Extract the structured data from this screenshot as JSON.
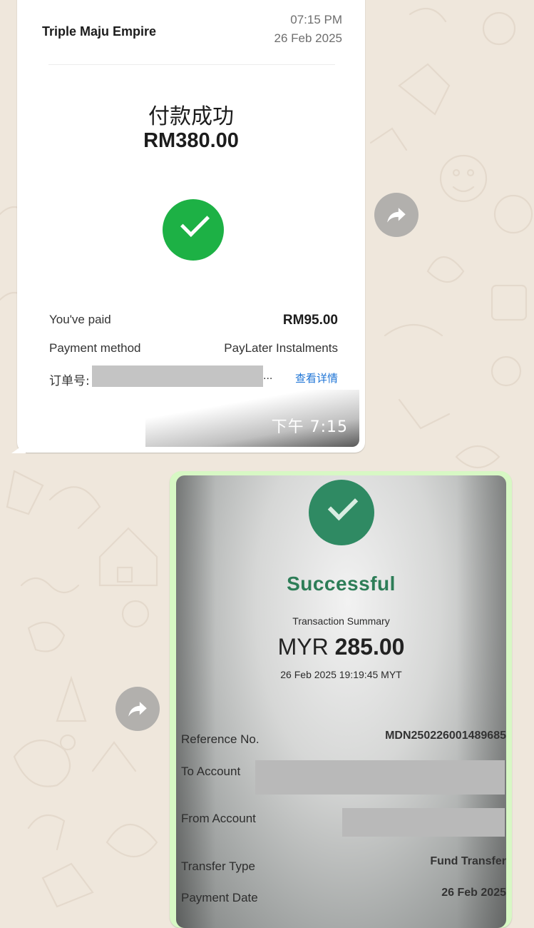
{
  "receipt_1": {
    "merchant": "Triple Maju Empire",
    "time": "07:15 PM",
    "date": "26 Feb 2025",
    "status": "付款成功",
    "amount": "RM380.00",
    "paid_label": "You've paid",
    "paid_value": "RM95.00",
    "method_label": "Payment method",
    "method_value": "PayLater Instalments",
    "order_label": "订单号:",
    "order_ellipsis": "...",
    "detail_link": "查看详情",
    "message_time": "下午 7:15"
  },
  "receipt_2": {
    "status": "Successful",
    "summary_title": "Transaction Summary",
    "currency": "MYR",
    "amount": "285.00",
    "datetime": "26 Feb 2025 19:19:45 MYT",
    "reference_label": "Reference No.",
    "reference_value": "MDN250226001489685",
    "to_account_label": "To Account",
    "from_account_label": "From Account",
    "transfer_type_label": "Transfer Type",
    "transfer_type_value": "Fund Transfer",
    "payment_date_label": "Payment Date",
    "payment_date_value": "26 Feb 2025"
  },
  "icons": {
    "forward": "forward-arrow-icon",
    "checkmark": "check-circle-icon"
  },
  "colors": {
    "chat_background": "#efe7dc",
    "outgoing_bubble": "#d7f8c4",
    "success_green": "#1db145",
    "success_teal": "#2f8a63",
    "link_blue": "#1e74d6"
  }
}
